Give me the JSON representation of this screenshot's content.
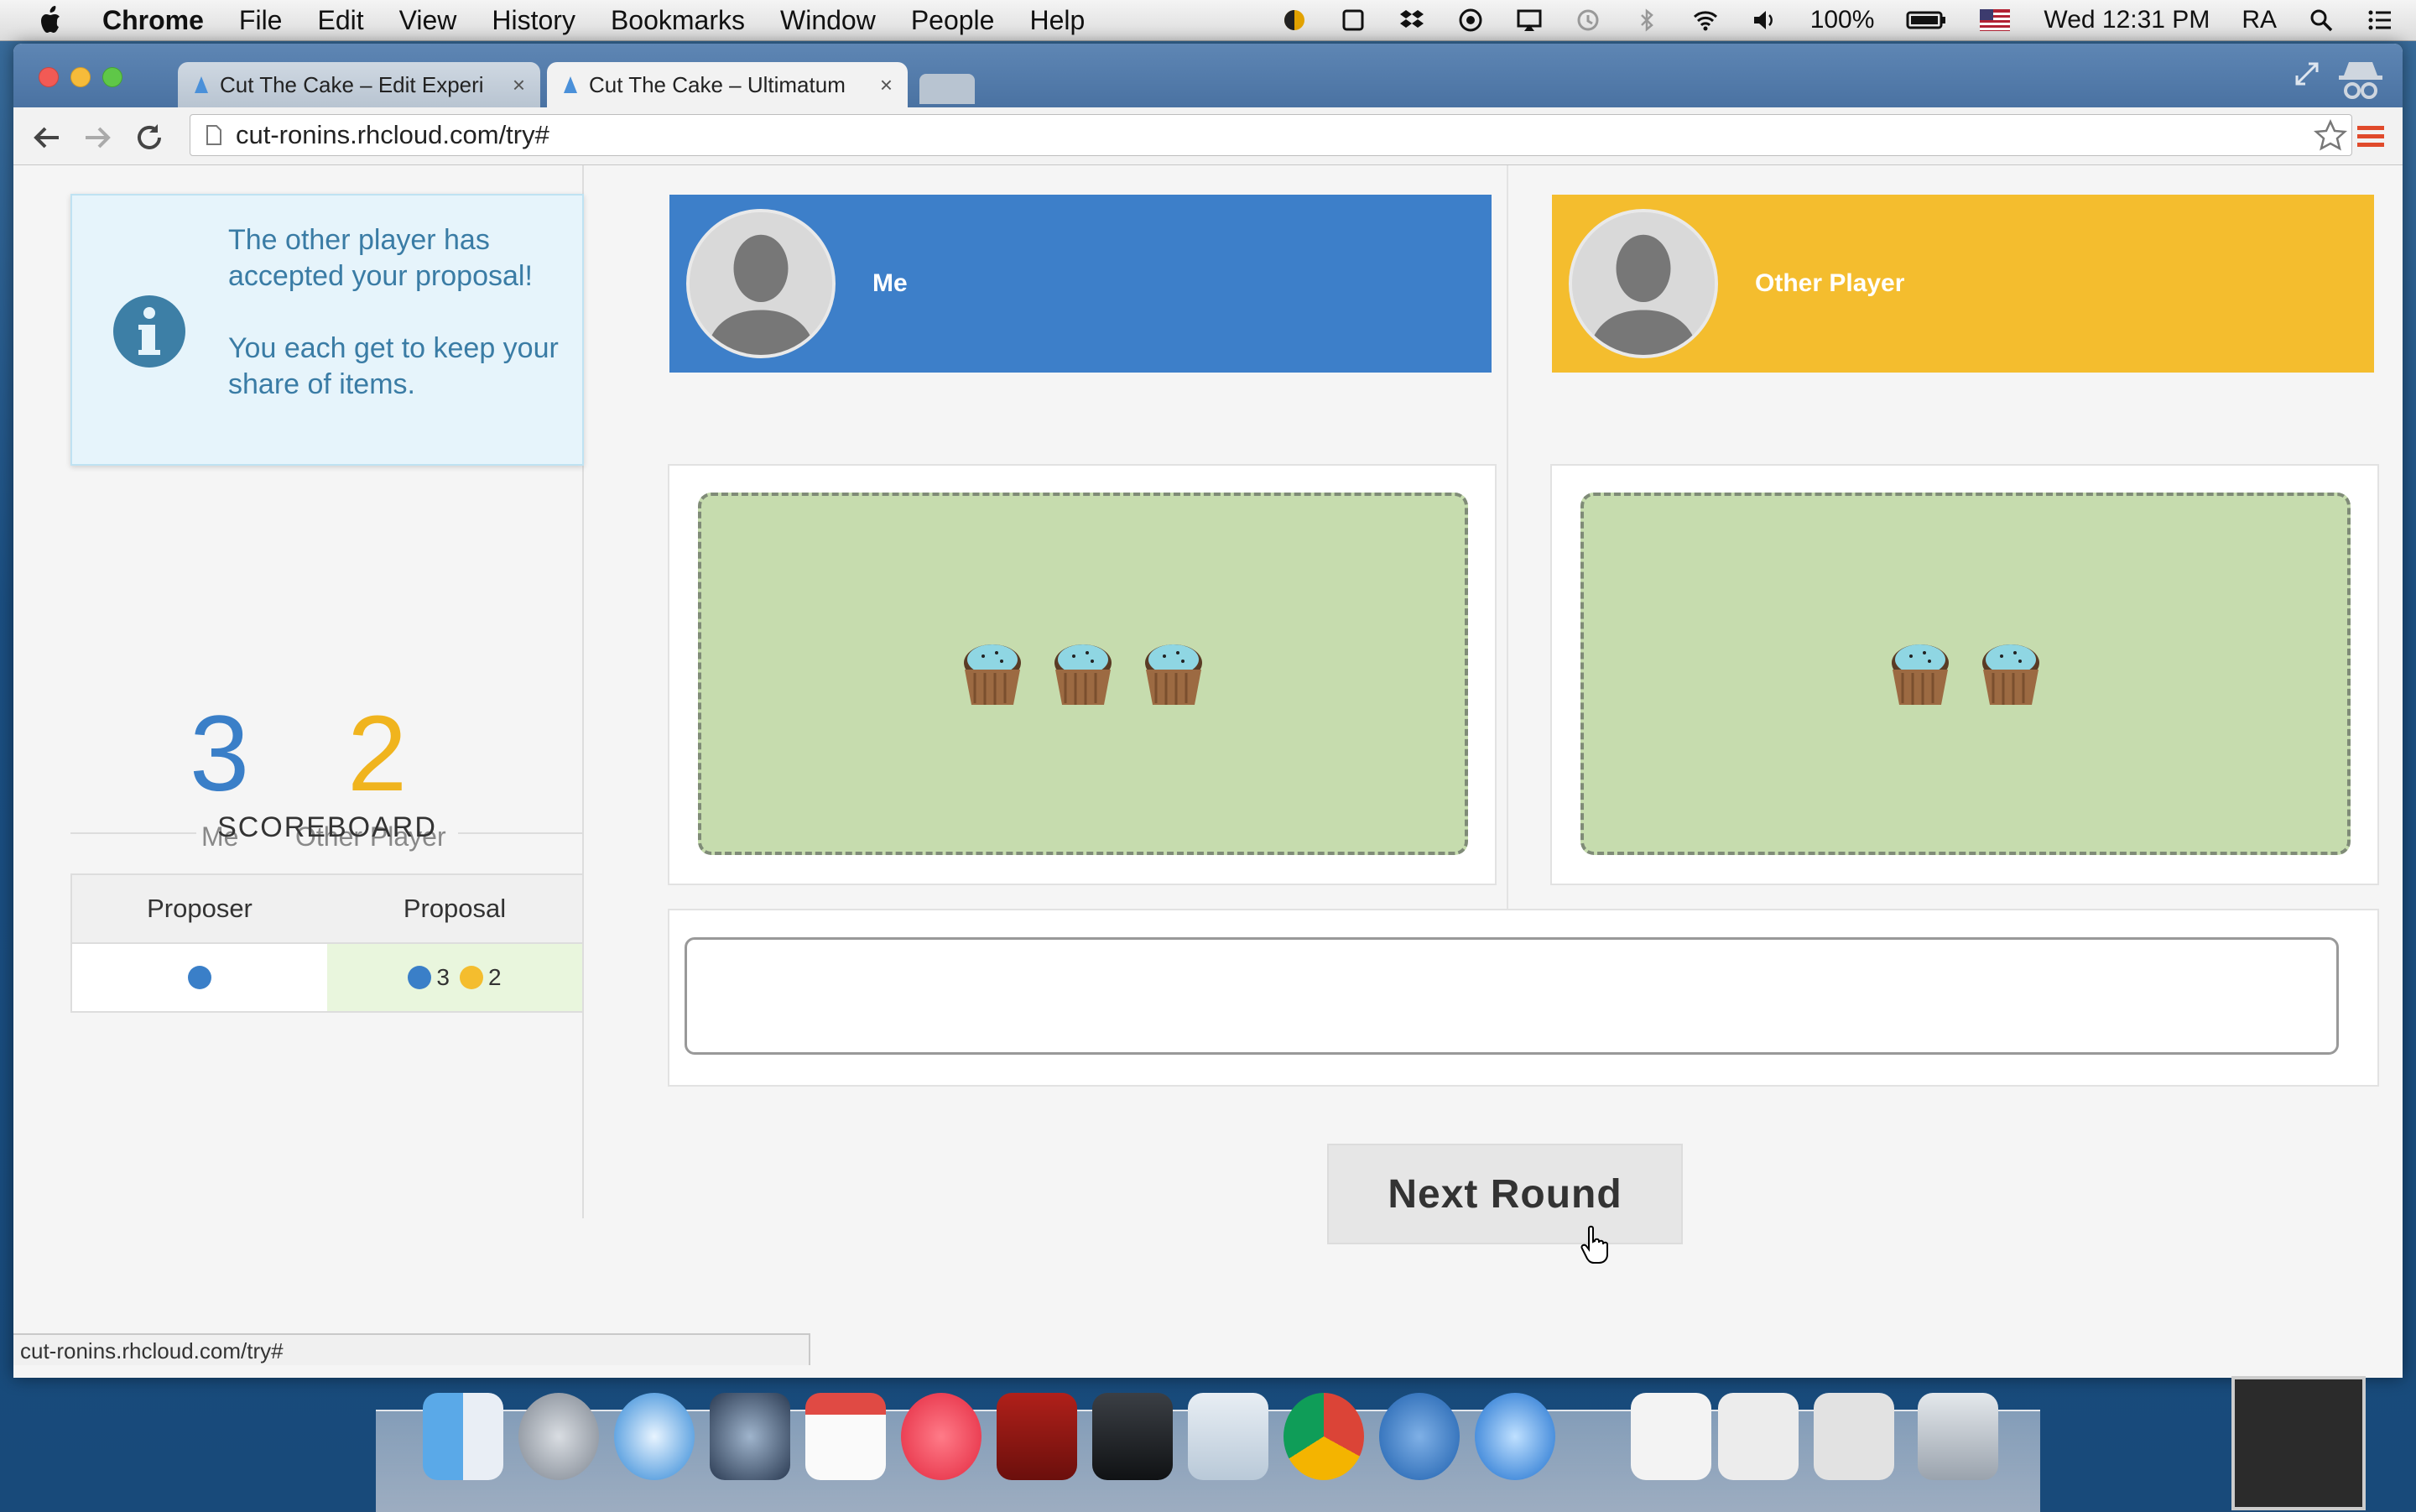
{
  "menubar": {
    "app": "Chrome",
    "items": [
      "File",
      "Edit",
      "View",
      "History",
      "Bookmarks",
      "Window",
      "People",
      "Help"
    ],
    "battery": "100%",
    "clock": "Wed 12:31 PM",
    "user": "RA"
  },
  "browser": {
    "tabs": [
      {
        "title": "Cut The Cake – Edit Experi",
        "close": "×"
      },
      {
        "title": "Cut The Cake – Ultimatum",
        "close": "×"
      }
    ],
    "url": "cut-ronins.rhcloud.com/try#",
    "status_url": "cut-ronins.rhcloud.com/try#"
  },
  "alert": {
    "line1": "The other player has accepted your proposal!",
    "line2": "You each get to keep your share of items."
  },
  "score": {
    "me_count": "3",
    "me_label": "Me",
    "other_count": "2",
    "other_label": "Other Player"
  },
  "scoreboard": {
    "title": "SCOREBOARD",
    "columns": [
      "Proposer",
      "Proposal"
    ],
    "rows": [
      {
        "proposer_color": "#3a7fc8",
        "me_share": "3",
        "other_share": "2"
      }
    ]
  },
  "players": {
    "me": {
      "name": "Me",
      "color": "#3d7fc9",
      "items": 3
    },
    "other": {
      "name": "Other Player",
      "color": "#f4bd2e",
      "items": 2
    }
  },
  "colors": {
    "me": "#3d7fc9",
    "other": "#f4bd2e"
  },
  "next_button": "Next Round"
}
